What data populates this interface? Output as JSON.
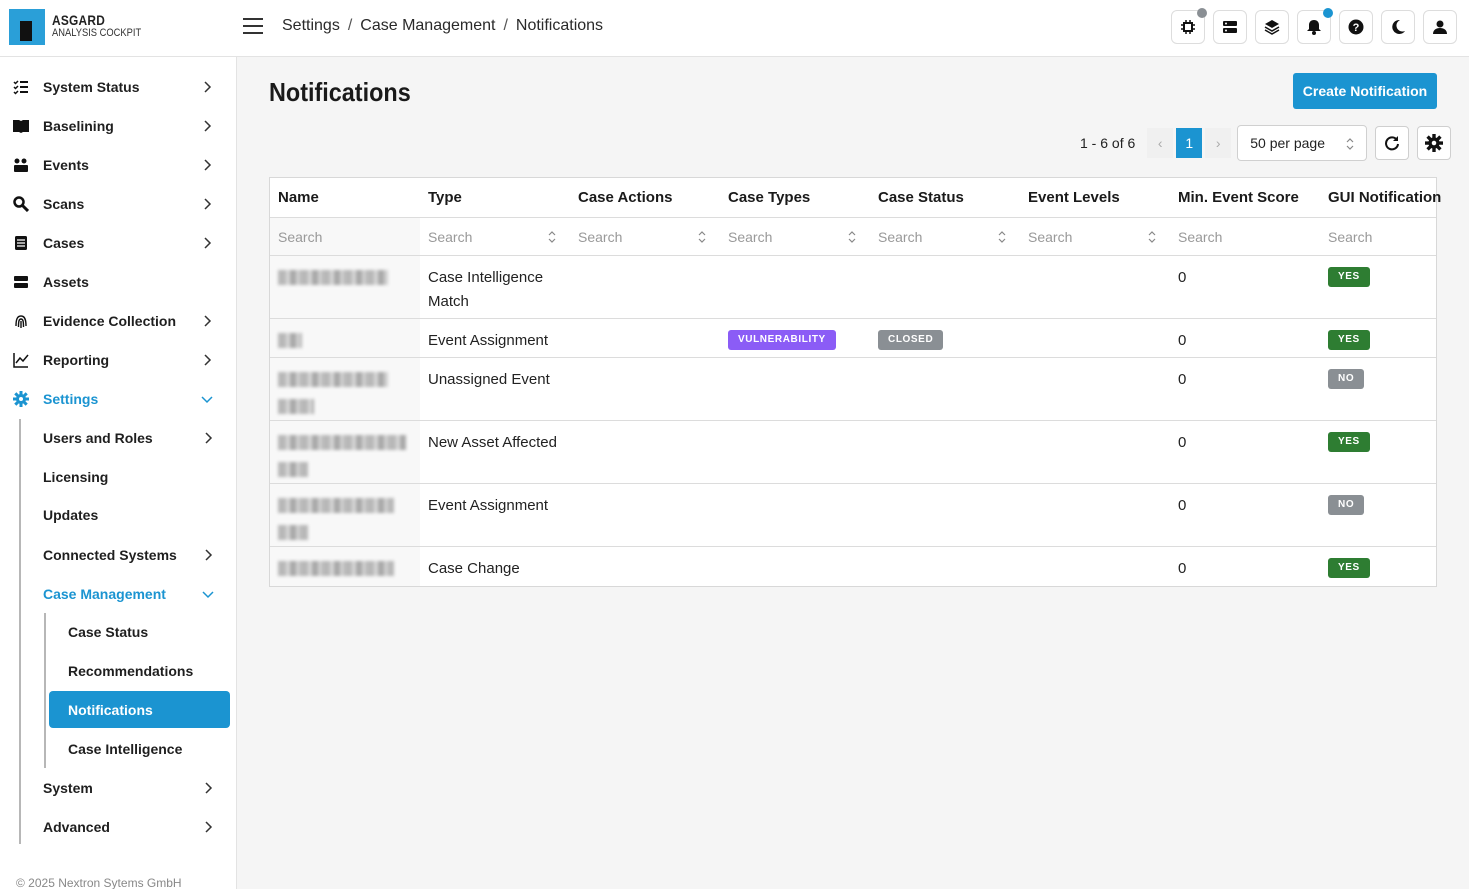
{
  "app": {
    "logo_line1": "ASGARD",
    "logo_line2": "ANALYSIS COCKPIT",
    "accent_color": "#1b94d1"
  },
  "breadcrumb": [
    "Settings",
    "Case Management",
    "Notifications"
  ],
  "top_icons": [
    "chip-icon",
    "server-icon",
    "layers-icon",
    "bell-icon",
    "help-icon",
    "moon-icon",
    "user-icon"
  ],
  "sidebar": {
    "items": [
      {
        "label": "System Status",
        "icon": "checklist-icon"
      },
      {
        "label": "Baselining",
        "icon": "book-icon"
      },
      {
        "label": "Events",
        "icon": "events-icon"
      },
      {
        "label": "Scans",
        "icon": "scan-icon"
      },
      {
        "label": "Cases",
        "icon": "cases-icon"
      },
      {
        "label": "Assets",
        "icon": "assets-icon"
      },
      {
        "label": "Evidence Collection",
        "icon": "fingerprint-icon"
      },
      {
        "label": "Reporting",
        "icon": "chart-icon"
      },
      {
        "label": "Settings",
        "icon": "gear-icon"
      }
    ],
    "settings_children": [
      "Users and Roles",
      "Licensing",
      "Updates",
      "Connected Systems",
      "Case Management",
      "System",
      "Advanced"
    ],
    "case_management_children": [
      "Case Status",
      "Recommendations",
      "Notifications",
      "Case Intelligence"
    ],
    "footer": "© 2025 Nextron Sytems GmbH"
  },
  "main": {
    "title": "Notifications",
    "create_button": "Create Notification",
    "pagination": {
      "count": "1 - 6 of 6",
      "prev": "‹",
      "current_page": "1",
      "next": "›",
      "per_page": "50 per page"
    },
    "table": {
      "columns": [
        "Name",
        "Type",
        "Case Actions",
        "Case Types",
        "Case Status",
        "Event Levels",
        "Min. Event Score",
        "GUI Notification"
      ],
      "search_placeholder": "Search",
      "rows": [
        {
          "type_line1": "Case Intelligence",
          "type_line2": "Match",
          "case_type": "",
          "case_status": "",
          "min_score": "0",
          "gui": "YES"
        },
        {
          "type_line1": "Event Assignment",
          "type_line2": "",
          "case_type": "VULNERABILITY",
          "case_status": "CLOSED",
          "min_score": "0",
          "gui": "YES"
        },
        {
          "type_line1": "Unassigned Event",
          "type_line2": "",
          "case_type": "",
          "case_status": "",
          "min_score": "0",
          "gui": "NO"
        },
        {
          "type_line1": "New Asset Affected",
          "type_line2": "",
          "case_type": "",
          "case_status": "",
          "min_score": "0",
          "gui": "YES"
        },
        {
          "type_line1": "Event Assignment",
          "type_line2": "",
          "case_type": "",
          "case_status": "",
          "min_score": "0",
          "gui": "NO"
        },
        {
          "type_line1": "Case Change",
          "type_line2": "",
          "case_type": "",
          "case_status": "",
          "min_score": "0",
          "gui": "YES"
        }
      ]
    },
    "badge_colors": {
      "yes": "#2e7d32",
      "no": "#8a8f94",
      "vulnerability": "#8b5cf6",
      "closed": "#8a8f94"
    }
  }
}
